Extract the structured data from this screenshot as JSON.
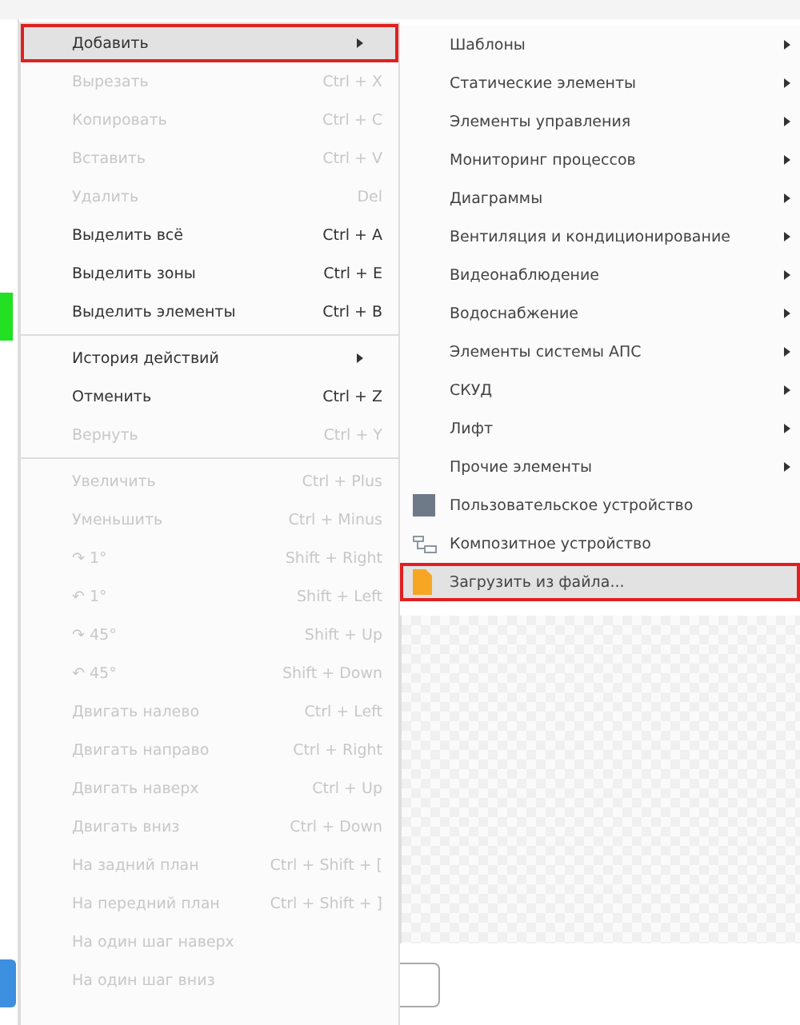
{
  "menu": {
    "groups": [
      {
        "items": [
          {
            "label": "Добавить",
            "kind": "submenu",
            "disabled": false,
            "selected": true
          },
          {
            "label": "Вырезать",
            "shortcut": "Ctrl + X",
            "kind": "command",
            "disabled": true,
            "selected": false
          },
          {
            "label": "Копировать",
            "shortcut": "Ctrl + C",
            "kind": "command",
            "disabled": true,
            "selected": false
          },
          {
            "label": "Вставить",
            "shortcut": "Ctrl + V",
            "kind": "command",
            "disabled": true,
            "selected": false
          },
          {
            "label": "Удалить",
            "shortcut": "Del",
            "kind": "command",
            "disabled": true,
            "selected": false
          },
          {
            "label": "Выделить всё",
            "shortcut": "Ctrl + A",
            "kind": "command",
            "disabled": false,
            "selected": false
          },
          {
            "label": "Выделить зоны",
            "shortcut": "Ctrl + E",
            "kind": "command",
            "disabled": false,
            "selected": false
          },
          {
            "label": "Выделить элементы",
            "shortcut": "Ctrl + B",
            "kind": "command",
            "disabled": false,
            "selected": false
          }
        ]
      },
      {
        "items": [
          {
            "label": "История действий",
            "kind": "submenu",
            "disabled": false,
            "selected": false
          },
          {
            "label": "Отменить",
            "shortcut": "Ctrl + Z",
            "kind": "command",
            "disabled": false,
            "selected": false
          },
          {
            "label": "Вернуть",
            "shortcut": "Ctrl + Y",
            "kind": "command",
            "disabled": true,
            "selected": false
          }
        ]
      },
      {
        "items": [
          {
            "label": "Увеличить",
            "shortcut": "Ctrl + Plus",
            "kind": "command",
            "disabled": true,
            "selected": false
          },
          {
            "label": "Уменьшить",
            "shortcut": "Ctrl + Minus",
            "kind": "command",
            "disabled": true,
            "selected": false
          },
          {
            "label": "↷ 1°",
            "shortcut": "Shift + Right",
            "kind": "command",
            "disabled": true,
            "selected": false
          },
          {
            "label": "↶ 1°",
            "shortcut": "Shift + Left",
            "kind": "command",
            "disabled": true,
            "selected": false
          },
          {
            "label": "↷ 45°",
            "shortcut": "Shift + Up",
            "kind": "command",
            "disabled": true,
            "selected": false
          },
          {
            "label": "↶ 45°",
            "shortcut": "Shift + Down",
            "kind": "command",
            "disabled": true,
            "selected": false
          },
          {
            "label": "Двигать налево",
            "shortcut": "Ctrl + Left",
            "kind": "command",
            "disabled": true,
            "selected": false
          },
          {
            "label": "Двигать направо",
            "shortcut": "Ctrl + Right",
            "kind": "command",
            "disabled": true,
            "selected": false
          },
          {
            "label": "Двигать наверх",
            "shortcut": "Ctrl + Up",
            "kind": "command",
            "disabled": true,
            "selected": false
          },
          {
            "label": "Двигать вниз",
            "shortcut": "Ctrl + Down",
            "kind": "command",
            "disabled": true,
            "selected": false
          },
          {
            "label": "На задний план",
            "shortcut": "Ctrl + Shift + [",
            "kind": "command",
            "disabled": true,
            "selected": false
          },
          {
            "label": "На передний план",
            "shortcut": "Ctrl + Shift + ]",
            "kind": "command",
            "disabled": true,
            "selected": false
          },
          {
            "label": "На один шаг наверх",
            "kind": "command",
            "disabled": true,
            "selected": false
          },
          {
            "label": "На один шаг вниз",
            "kind": "command",
            "disabled": true,
            "selected": false
          }
        ]
      }
    ]
  },
  "submenu": {
    "items": [
      {
        "label": "Шаблоны",
        "kind": "submenu",
        "selected": false
      },
      {
        "label": "Статические элементы",
        "kind": "submenu",
        "selected": false
      },
      {
        "label": "Элементы управления",
        "kind": "submenu",
        "selected": false
      },
      {
        "label": "Мониторинг процессов",
        "kind": "submenu",
        "selected": false
      },
      {
        "label": "Диаграммы",
        "kind": "submenu",
        "selected": false
      },
      {
        "label": "Вентиляция и кондиционирование",
        "kind": "submenu",
        "selected": false
      },
      {
        "label": "Видеонаблюдение",
        "kind": "submenu",
        "selected": false
      },
      {
        "label": "Водоснабжение",
        "kind": "submenu",
        "selected": false
      },
      {
        "label": "Элементы системы АПС",
        "kind": "submenu",
        "selected": false
      },
      {
        "label": "СКУД",
        "kind": "submenu",
        "selected": false
      },
      {
        "label": "Лифт",
        "kind": "submenu",
        "selected": false
      },
      {
        "label": "Прочие элементы",
        "kind": "submenu",
        "selected": false
      },
      {
        "label": "Пользовательское устройство",
        "kind": "device",
        "selected": false
      },
      {
        "label": "Композитное устройство",
        "kind": "composite",
        "selected": false
      },
      {
        "label": "Загрузить из файла...",
        "kind": "file",
        "selected": true
      }
    ]
  }
}
